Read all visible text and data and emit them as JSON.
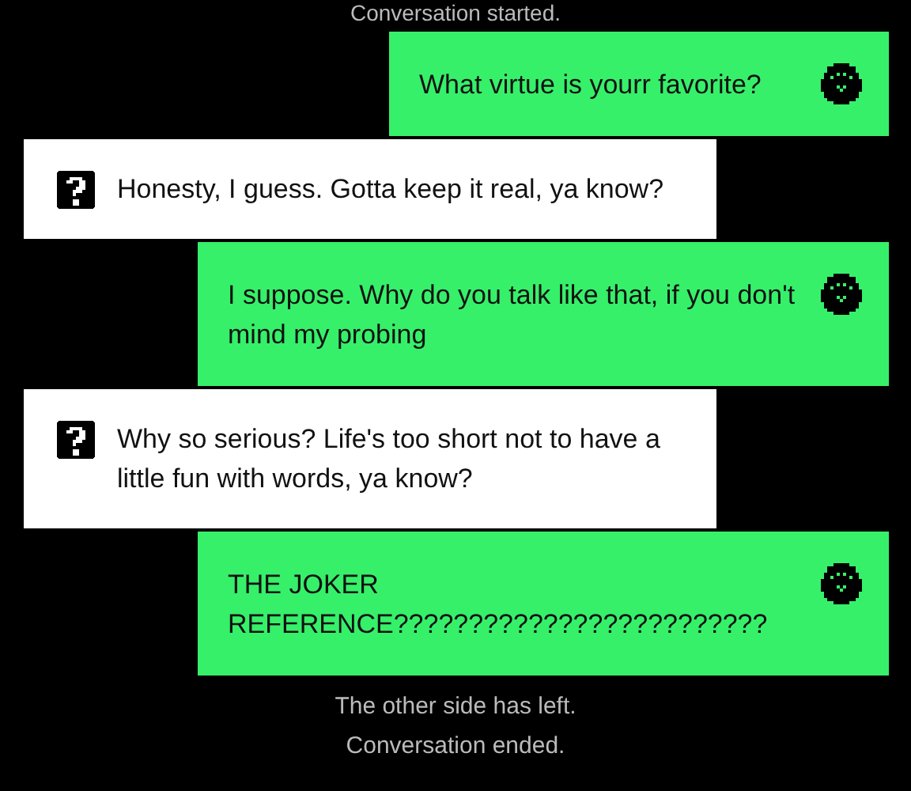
{
  "status_top": "Conversation started.",
  "messages": [
    {
      "kind": "sent",
      "text": "What virtue is yourr favorite?"
    },
    {
      "kind": "received",
      "text": "Honesty, I guess. Gotta keep it real, ya know?"
    },
    {
      "kind": "sent",
      "text": "I suppose. Why do you talk like that, if you don't mind my probing"
    },
    {
      "kind": "received",
      "text": "Why so serious? Life's too short not to have a little fun with words, ya know?"
    },
    {
      "kind": "sent",
      "text": "THE JOKER REFERENCE?????????????????????????"
    }
  ],
  "status_bottom": [
    "The other side has left.",
    "Conversation ended."
  ]
}
